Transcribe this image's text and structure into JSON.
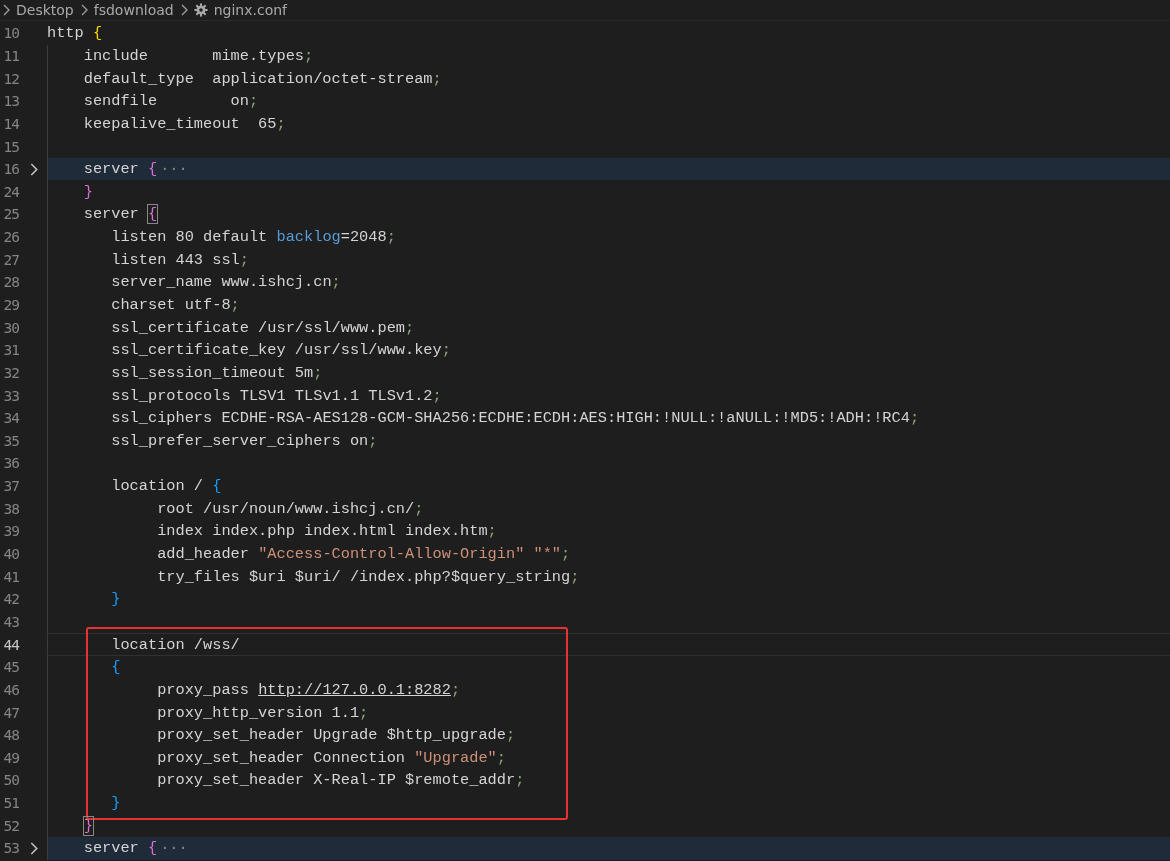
{
  "breadcrumb": [
    {
      "kind": "folder",
      "text": "Desktop"
    },
    {
      "kind": "folder",
      "text": "fsdownload"
    },
    {
      "kind": "file",
      "text": "nginx.conf"
    }
  ],
  "lines": [
    {
      "number": "10",
      "folded": false,
      "current": false,
      "tokens": [
        {
          "kind": "text",
          "text": "http "
        },
        {
          "kind": "brace",
          "text": "{",
          "color": "#ffd700"
        }
      ],
      "children": [
        {
          "number": "11",
          "folded": false,
          "current": false,
          "tokens": [
            {
              "kind": "text",
              "text": "include       mime.types"
            },
            {
              "kind": "punct",
              "text": ";"
            }
          ]
        },
        {
          "number": "12",
          "folded": false,
          "current": false,
          "tokens": [
            {
              "kind": "text",
              "text": "default_type  application/octet-stream"
            },
            {
              "kind": "punct",
              "text": ";"
            }
          ]
        },
        {
          "number": "13",
          "folded": false,
          "current": false,
          "tokens": [
            {
              "kind": "text",
              "text": "sendfile        on"
            },
            {
              "kind": "punct",
              "text": ";"
            }
          ]
        },
        {
          "number": "14",
          "folded": false,
          "current": false,
          "tokens": [
            {
              "kind": "text",
              "text": "keepalive_timeout  65"
            },
            {
              "kind": "punct",
              "text": ";"
            }
          ]
        },
        {
          "number": "15",
          "folded": false,
          "current": false
        },
        {
          "number": "16",
          "folded": true,
          "current": false,
          "tokens": [
            {
              "kind": "text",
              "text": "server "
            },
            {
              "kind": "brace",
              "text": "{",
              "color": "#da70d6"
            },
            {
              "kind": "ellipsis",
              "text": "···"
            }
          ]
        },
        {
          "number": "24",
          "folded": false,
          "current": false,
          "tokens": [
            {
              "kind": "brace",
              "text": "}",
              "color": "#da70d6"
            }
          ]
        },
        {
          "number": "25",
          "folded": false,
          "current": false,
          "tokens": [
            {
              "kind": "text",
              "text": "server "
            },
            {
              "kind": "brace",
              "text": "{",
              "color": "#da70d6",
              "matched": true
            }
          ],
          "children": [
            {
              "number": "26",
              "folded": false,
              "current": false,
              "tokens": [
                {
                  "kind": "text",
                  "text": "listen 80 default "
                },
                {
                  "kind": "keyword",
                  "text": "backlog"
                },
                {
                  "kind": "text",
                  "text": "=2048"
                },
                {
                  "kind": "punct",
                  "text": ";"
                }
              ]
            },
            {
              "number": "27",
              "folded": false,
              "current": false,
              "tokens": [
                {
                  "kind": "text",
                  "text": "listen 443 ssl"
                },
                {
                  "kind": "punct",
                  "text": ";"
                }
              ]
            },
            {
              "number": "28",
              "folded": false,
              "current": false,
              "tokens": [
                {
                  "kind": "text",
                  "text": "server_name www.ishcj.cn"
                },
                {
                  "kind": "punct",
                  "text": ";"
                }
              ]
            },
            {
              "number": "29",
              "folded": false,
              "current": false,
              "tokens": [
                {
                  "kind": "text",
                  "text": "charset utf-8"
                },
                {
                  "kind": "punct",
                  "text": ";"
                }
              ]
            },
            {
              "number": "30",
              "folded": false,
              "current": false,
              "tokens": [
                {
                  "kind": "text",
                  "text": "ssl_certificate /usr/ssl/www.pem"
                },
                {
                  "kind": "punct",
                  "text": ";"
                }
              ]
            },
            {
              "number": "31",
              "folded": false,
              "current": false,
              "tokens": [
                {
                  "kind": "text",
                  "text": "ssl_certificate_key /usr/ssl/www.key"
                },
                {
                  "kind": "punct",
                  "text": ";"
                }
              ]
            },
            {
              "number": "32",
              "folded": false,
              "current": false,
              "tokens": [
                {
                  "kind": "text",
                  "text": "ssl_session_timeout 5m"
                },
                {
                  "kind": "punct",
                  "text": ";"
                }
              ]
            },
            {
              "number": "33",
              "folded": false,
              "current": false,
              "tokens": [
                {
                  "kind": "text",
                  "text": "ssl_protocols TLSV1 TLSv1.1 TLSv1.2"
                },
                {
                  "kind": "punct",
                  "text": ";"
                }
              ]
            },
            {
              "number": "34",
              "folded": false,
              "current": false,
              "tokens": [
                {
                  "kind": "text",
                  "text": "ssl_ciphers ECDHE-RSA-AES128-GCM-SHA256:ECDHE:ECDH:AES:HIGH:!NULL:!aNULL:!MD5:!ADH:!RC4"
                },
                {
                  "kind": "punct",
                  "text": ";"
                }
              ]
            },
            {
              "number": "35",
              "folded": false,
              "current": false,
              "tokens": [
                {
                  "kind": "text",
                  "text": "ssl_prefer_server_ciphers on"
                },
                {
                  "kind": "punct",
                  "text": ";"
                }
              ]
            },
            {
              "number": "36",
              "folded": false,
              "current": false
            },
            {
              "number": "37",
              "folded": false,
              "current": false,
              "tokens": [
                {
                  "kind": "text",
                  "text": "location / "
                },
                {
                  "kind": "brace",
                  "text": "{",
                  "color": "#179fff"
                }
              ],
              "children": [
                {
                  "number": "38",
                  "folded": false,
                  "current": false,
                  "tokens": [
                    {
                      "kind": "text",
                      "text": "root /usr/noun/www.ishcj.cn/"
                    },
                    {
                      "kind": "punct",
                      "text": ";"
                    }
                  ]
                },
                {
                  "number": "39",
                  "folded": false,
                  "current": false,
                  "tokens": [
                    {
                      "kind": "text",
                      "text": "index index.php index.html index.htm"
                    },
                    {
                      "kind": "punct",
                      "text": ";"
                    }
                  ]
                },
                {
                  "number": "40",
                  "folded": false,
                  "current": false,
                  "tokens": [
                    {
                      "kind": "text",
                      "text": "add_header "
                    },
                    {
                      "kind": "string",
                      "text": "\"Access-Control-Allow-Origin\" \"*\""
                    },
                    {
                      "kind": "punct",
                      "text": ";"
                    }
                  ]
                },
                {
                  "number": "41",
                  "folded": false,
                  "current": false,
                  "tokens": [
                    {
                      "kind": "text",
                      "text": "try_files $uri $uri/ /index.php?$query_string"
                    },
                    {
                      "kind": "punct",
                      "text": ";"
                    }
                  ]
                }
              ]
            },
            {
              "number": "42",
              "folded": false,
              "current": false,
              "tokens": [
                {
                  "kind": "brace",
                  "text": "}",
                  "color": "#179fff"
                }
              ]
            },
            {
              "number": "43",
              "folded": false,
              "current": false
            },
            {
              "number": "44",
              "folded": false,
              "current": true,
              "annotation_start": true,
              "tokens": [
                {
                  "kind": "text",
                  "text": "location /wss/"
                }
              ]
            },
            {
              "number": "45",
              "folded": false,
              "current": false,
              "tokens": [
                {
                  "kind": "brace",
                  "text": "{",
                  "color": "#179fff"
                }
              ],
              "children": [
                {
                  "number": "46",
                  "folded": false,
                  "current": false,
                  "tokens": [
                    {
                      "kind": "text",
                      "text": "proxy_pass "
                    },
                    {
                      "kind": "link",
                      "text": "http://127.0.0.1:8282"
                    },
                    {
                      "kind": "punct",
                      "text": ";"
                    }
                  ]
                },
                {
                  "number": "47",
                  "folded": false,
                  "current": false,
                  "tokens": [
                    {
                      "kind": "text",
                      "text": "proxy_http_version 1.1"
                    },
                    {
                      "kind": "punct",
                      "text": ";"
                    }
                  ]
                },
                {
                  "number": "48",
                  "folded": false,
                  "current": false,
                  "tokens": [
                    {
                      "kind": "text",
                      "text": "proxy_set_header Upgrade $http_upgrade"
                    },
                    {
                      "kind": "punct",
                      "text": ";"
                    }
                  ]
                },
                {
                  "number": "49",
                  "folded": false,
                  "current": false,
                  "tokens": [
                    {
                      "kind": "text",
                      "text": "proxy_set_header Connection "
                    },
                    {
                      "kind": "string",
                      "text": "\"Upgrade\""
                    },
                    {
                      "kind": "punct",
                      "text": ";"
                    }
                  ]
                },
                {
                  "number": "50",
                  "folded": false,
                  "current": false,
                  "tokens": [
                    {
                      "kind": "text",
                      "text": "proxy_set_header X-Real-IP $remote_addr"
                    },
                    {
                      "kind": "punct",
                      "text": ";"
                    }
                  ]
                }
              ]
            },
            {
              "number": "51",
              "folded": false,
              "current": false,
              "annotation_end": true,
              "tokens": [
                {
                  "kind": "brace",
                  "text": "}",
                  "color": "#179fff"
                }
              ]
            }
          ]
        },
        {
          "number": "52",
          "folded": false,
          "current": false,
          "tokens": [
            {
              "kind": "brace",
              "text": "}",
              "color": "#da70d6",
              "matched": true
            }
          ]
        },
        {
          "number": "53",
          "folded": true,
          "current": false,
          "tokens": [
            {
              "kind": "text",
              "text": "server "
            },
            {
              "kind": "brace",
              "text": "{",
              "color": "#da70d6"
            },
            {
              "kind": "ellipsis",
              "text": "···"
            }
          ]
        }
      ]
    }
  ]
}
